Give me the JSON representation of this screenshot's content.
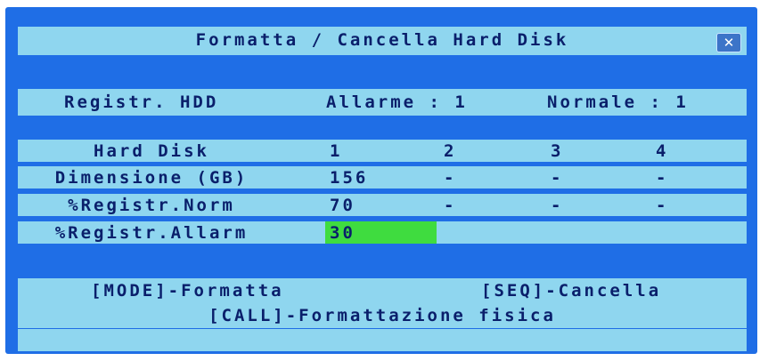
{
  "title": "Formatta / Cancella Hard Disk",
  "close_icon": "close-icon",
  "hdd_rec": {
    "label": "Registr. HDD",
    "alarm": "Allarme : 1",
    "normal": "Normale : 1"
  },
  "table": {
    "headers": [
      "Hard Disk",
      "1",
      "2",
      "3",
      "4"
    ],
    "rows": [
      {
        "label": "Dimensione (GB)",
        "values": [
          "156",
          "-",
          "-",
          "-"
        ]
      },
      {
        "label": "%Registr.Norm",
        "values": [
          "70",
          "-",
          "-",
          "-"
        ]
      },
      {
        "label": "%Registr.Allarm",
        "values": [
          "30"
        ]
      }
    ],
    "selected_color": "#3fdc3f"
  },
  "actions": {
    "mode": "[MODE]-Formatta",
    "seq": "[SEQ]-Cancella",
    "call": "[CALL]-Formattazione fisica"
  },
  "colors": {
    "background": "#1f6ee6",
    "bar": "#8fd6ef",
    "text": "#0a1f6b"
  }
}
